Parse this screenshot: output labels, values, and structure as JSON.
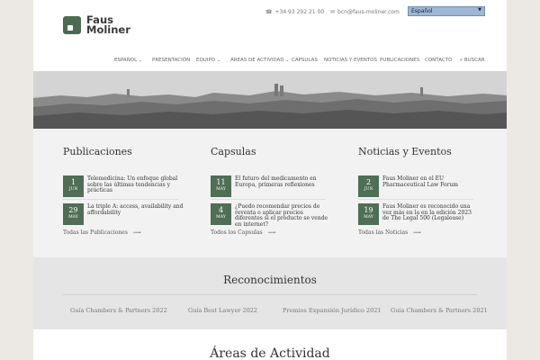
{
  "header": {
    "logo_text_line1": "Faus",
    "logo_text_line2": "Moliner",
    "phone": "+34 93 292 21 00",
    "email": "bcn@faus-moliner.com",
    "language_selected": "Español"
  },
  "nav": {
    "items": [
      "ESPAÑOL",
      "PRESENTACIÓN",
      "EQUIPO",
      "ÁREAS DE ACTIVIDAD",
      "CAPSULAS",
      "NOTICIAS Y EVENTOS",
      "PUBLICACIONES",
      "CONTACTO",
      "BUSCAR"
    ]
  },
  "columns": [
    {
      "title": "Publicaciones",
      "entries": [
        {
          "day": "1",
          "month": "JUN",
          "text": "Telemedicina: Un enfoque global sobre las últimas tendencias y prácticas"
        },
        {
          "day": "29",
          "month": "MAY",
          "text": "La triple A: access, availability and affordability"
        }
      ],
      "more": "Todas las Publicaciones"
    },
    {
      "title": "Capsulas",
      "entries": [
        {
          "day": "11",
          "month": "MAY",
          "text": "El futuro del medicamento en Europa, primeras reflexiones"
        },
        {
          "day": "4",
          "month": "MAY",
          "text": "¿Puedo recomendar precios de reventa o aplicar precios diferentes si el producto se vende en internet?"
        }
      ],
      "more": "Todos los Capsulas"
    },
    {
      "title": "Noticias y Eventos",
      "entries": [
        {
          "day": "2",
          "month": "JUN",
          "text": "Faus Moliner en el EU Pharmaceutical Law Forum"
        },
        {
          "day": "19",
          "month": "MAY",
          "text": "Faus Moliner es reconocido una vez más en la en la edición 2023 de The Legal 500 (Legalease)"
        }
      ],
      "more": "Todas las Noticias"
    }
  ],
  "reconocimientos": {
    "title": "Reconocimientos",
    "awards": [
      "Guía Chambers & Partners 2022",
      "Guía Best Lawyer 2022",
      "Premios Expansión Jurídico 2021",
      "Guía Chambers & Partners 2021"
    ]
  },
  "areas": {
    "title": "Áreas de Actividad"
  },
  "colors": {
    "accent": "#4f6e56",
    "lang_bg": "#9eb8d4"
  }
}
